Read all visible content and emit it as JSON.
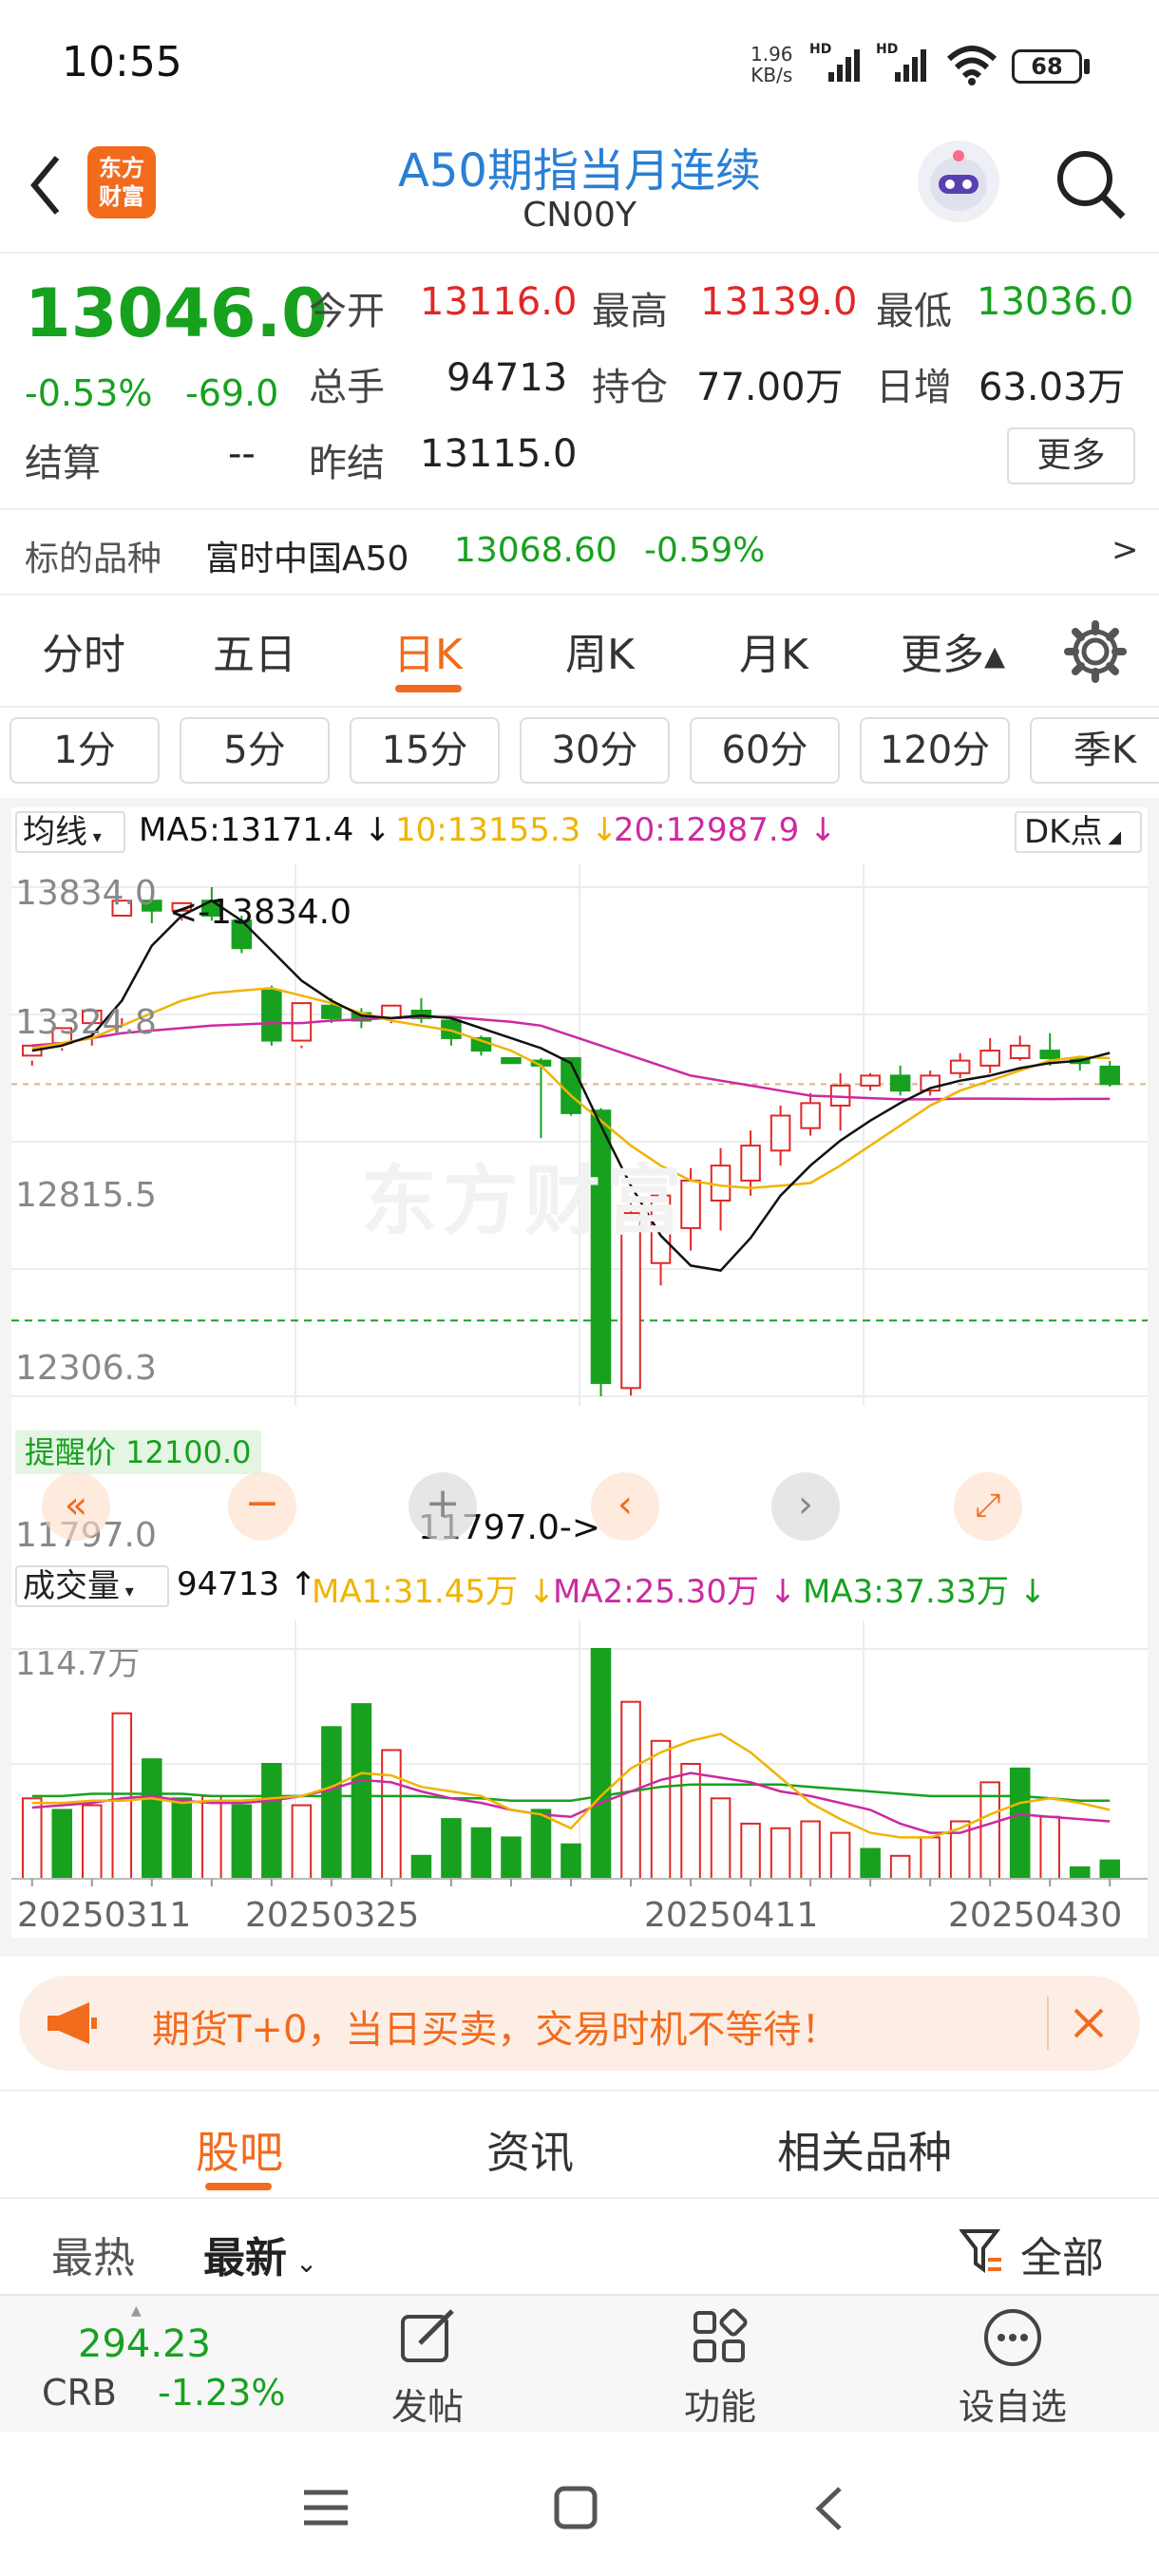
{
  "status": {
    "time": "10:55",
    "speed_top": "1.96",
    "speed_bottom": "KB/s",
    "net1": "HD",
    "net2": "HD",
    "battery": "68"
  },
  "header": {
    "title": "A50期指当月连续",
    "code": "CN00Y",
    "logo_line1": "东方",
    "logo_line2": "财富"
  },
  "quote": {
    "price": "13046.0",
    "change_pct": "-0.53%",
    "change": "-69.0",
    "open_label": "今开",
    "open": "13116.0",
    "high_label": "最高",
    "high": "13139.0",
    "low_label": "最低",
    "low": "13036.0",
    "volume_label": "总手",
    "volume": "94713",
    "oi_label": "持仓",
    "oi": "77.00万",
    "daily_inc_label": "日增",
    "daily_inc": "63.03万",
    "settle_label": "结算",
    "settle": "--",
    "prev_settle_label": "昨结",
    "prev_settle": "13115.0",
    "more": "更多",
    "underlying_label": "标的品种",
    "underlying_name": "富时中国A50",
    "underlying_price": "13068.60",
    "underlying_pct": "-0.59%",
    "underlying_arrow": ">"
  },
  "tabs": {
    "items": [
      "分时",
      "五日",
      "日K",
      "周K",
      "月K",
      "更多▴"
    ],
    "active": 2
  },
  "periods": [
    "1分",
    "5分",
    "15分",
    "30分",
    "60分",
    "120分",
    "季K"
  ],
  "ma_bar": {
    "selector": "均线",
    "ma5": "MA5:13171.4",
    "ma10": "10:13155.3",
    "ma20": "20:12987.9",
    "dk": "DK点"
  },
  "vol_bar": {
    "selector": "成交量",
    "vol": "94713",
    "ma1": "MA1:31.45万",
    "ma2": "MA2:25.30万",
    "ma3": "MA3:37.33万",
    "max": "114.7万"
  },
  "colors": {
    "up": "#e02828",
    "down": "#17a11f",
    "accent": "#f26b1d",
    "ma5": "#111111",
    "ma10": "#f0b400",
    "ma20": "#cc2aa0",
    "title": "#2a7fd4"
  },
  "chart_data": {
    "type": "candlestick",
    "y_ticks": [
      "13834.0",
      "13324.8",
      "12815.5",
      "12306.3",
      "11797.0"
    ],
    "ylim": [
      11797.0,
      13834.0
    ],
    "x_ticks": [
      "20250311",
      "20250325",
      "20250411",
      "20250430"
    ],
    "annot_high": "<-13834.0",
    "annot_low": "11797.0->",
    "alert_label": "提醒价 12100.0",
    "alert_value": 12100.0,
    "candles": [
      [
        13160,
        13200,
        13140,
        13120
      ],
      [
        13210,
        13270,
        13190,
        13180
      ],
      [
        13290,
        13340,
        13260,
        13200
      ],
      [
        13720,
        13780,
        13310,
        13280
      ],
      [
        13780,
        13740,
        13800,
        13690
      ],
      [
        13740,
        13770,
        13720,
        13700
      ],
      [
        13780,
        13720,
        13834,
        13700
      ],
      [
        13700,
        13590,
        13720,
        13570
      ],
      [
        13420,
        13220,
        13440,
        13200
      ],
      [
        13220,
        13370,
        13200,
        13190
      ],
      [
        13360,
        13310,
        13390,
        13290
      ],
      [
        13330,
        13300,
        13350,
        13270
      ],
      [
        13310,
        13360,
        13300,
        13290
      ],
      [
        13340,
        13310,
        13390,
        13290
      ],
      [
        13300,
        13230,
        13310,
        13200
      ],
      [
        13230,
        13180,
        13240,
        13160
      ],
      [
        13150,
        13130,
        13150,
        13130
      ],
      [
        13140,
        13120,
        13150,
        12830
      ],
      [
        13150,
        12930,
        13150,
        12920
      ],
      [
        12940,
        11850,
        12950,
        11797
      ],
      [
        11830,
        12530,
        12570,
        11800
      ],
      [
        12330,
        12600,
        12580,
        12240
      ],
      [
        12470,
        12660,
        12710,
        12380
      ],
      [
        12580,
        12720,
        12790,
        12460
      ],
      [
        12660,
        12800,
        12860,
        12600
      ],
      [
        12780,
        12920,
        12960,
        12720
      ],
      [
        12870,
        12970,
        13010,
        12840
      ],
      [
        12960,
        13040,
        13090,
        12860
      ],
      [
        13040,
        13080,
        13090,
        13020
      ],
      [
        13080,
        13020,
        13120,
        13000
      ],
      [
        13020,
        13080,
        13100,
        13000
      ],
      [
        13090,
        13140,
        13170,
        13070
      ],
      [
        13120,
        13180,
        13230,
        13090
      ],
      [
        13150,
        13200,
        13240,
        13140
      ],
      [
        13180,
        13150,
        13250,
        13120
      ],
      [
        13150,
        13130,
        13160,
        13100
      ],
      [
        13116,
        13046,
        13139,
        13036
      ]
    ],
    "ma5": [
      13180,
      13200,
      13240,
      13380,
      13600,
      13720,
      13780,
      13700,
      13580,
      13460,
      13380,
      13320,
      13310,
      13320,
      13310,
      13270,
      13230,
      13190,
      13130,
      12880,
      12640,
      12440,
      12320,
      12300,
      12430,
      12600,
      12720,
      12820,
      12900,
      12970,
      13030,
      13060,
      13080,
      13110,
      13130,
      13140,
      13171
    ],
    "ma10": [
      13190,
      13210,
      13230,
      13280,
      13330,
      13380,
      13410,
      13420,
      13430,
      13400,
      13370,
      13330,
      13300,
      13280,
      13260,
      13220,
      13180,
      13120,
      13000,
      12900,
      12800,
      12720,
      12660,
      12640,
      12630,
      12640,
      12650,
      12720,
      12800,
      12880,
      12960,
      13020,
      13060,
      13100,
      13140,
      13155,
      13150
    ],
    "ma20": [
      13200,
      13210,
      13230,
      13250,
      13260,
      13270,
      13280,
      13285,
      13290,
      13290,
      13300,
      13305,
      13310,
      13315,
      13315,
      13305,
      13295,
      13280,
      13240,
      13200,
      13160,
      13120,
      13080,
      13060,
      13040,
      13020,
      13000,
      12995,
      12990,
      12985,
      12985,
      12988,
      12988,
      12987,
      12986,
      12987,
      12987
    ],
    "volume": [
      [
        0.35,
        1
      ],
      [
        0.3,
        0
      ],
      [
        0.32,
        1
      ],
      [
        0.72,
        1
      ],
      [
        0.52,
        0
      ],
      [
        0.35,
        0
      ],
      [
        0.36,
        1
      ],
      [
        0.32,
        0
      ],
      [
        0.5,
        0
      ],
      [
        0.32,
        1
      ],
      [
        0.66,
        0
      ],
      [
        0.76,
        0
      ],
      [
        0.56,
        1
      ],
      [
        0.1,
        0
      ],
      [
        0.26,
        0
      ],
      [
        0.22,
        0
      ],
      [
        0.18,
        0
      ],
      [
        0.3,
        0
      ],
      [
        0.15,
        0
      ],
      [
        1.0,
        0
      ],
      [
        0.77,
        1
      ],
      [
        0.6,
        1
      ],
      [
        0.5,
        1
      ],
      [
        0.35,
        1
      ],
      [
        0.24,
        1
      ],
      [
        0.22,
        1
      ],
      [
        0.25,
        1
      ],
      [
        0.2,
        1
      ],
      [
        0.13,
        0
      ],
      [
        0.1,
        1
      ],
      [
        0.18,
        1
      ],
      [
        0.25,
        1
      ],
      [
        0.42,
        1
      ],
      [
        0.48,
        0
      ],
      [
        0.27,
        1
      ],
      [
        0.05,
        0
      ],
      [
        0.08,
        0
      ]
    ],
    "vol_ma1": [
      0.33,
      0.33,
      0.34,
      0.34,
      0.35,
      0.33,
      0.34,
      0.34,
      0.35,
      0.36,
      0.4,
      0.46,
      0.45,
      0.4,
      0.38,
      0.36,
      0.3,
      0.28,
      0.22,
      0.36,
      0.48,
      0.55,
      0.6,
      0.63,
      0.55,
      0.44,
      0.33,
      0.26,
      0.2,
      0.18,
      0.18,
      0.22,
      0.28,
      0.33,
      0.35,
      0.33,
      0.3
    ],
    "vol_ma2": [
      0.31,
      0.32,
      0.33,
      0.35,
      0.36,
      0.34,
      0.33,
      0.33,
      0.34,
      0.36,
      0.39,
      0.43,
      0.42,
      0.38,
      0.35,
      0.33,
      0.3,
      0.28,
      0.27,
      0.33,
      0.38,
      0.43,
      0.46,
      0.44,
      0.42,
      0.38,
      0.36,
      0.33,
      0.3,
      0.24,
      0.2,
      0.2,
      0.24,
      0.28,
      0.27,
      0.26,
      0.25
    ],
    "vol_ma3": [
      0.36,
      0.36,
      0.37,
      0.37,
      0.37,
      0.37,
      0.36,
      0.36,
      0.36,
      0.36,
      0.36,
      0.36,
      0.36,
      0.36,
      0.35,
      0.35,
      0.34,
      0.34,
      0.34,
      0.36,
      0.38,
      0.4,
      0.41,
      0.41,
      0.41,
      0.41,
      0.4,
      0.39,
      0.38,
      0.37,
      0.36,
      0.36,
      0.36,
      0.36,
      0.35,
      0.34,
      0.34
    ]
  },
  "watermark": "东方财富",
  "banner": {
    "text": "期货T+0，当日买卖，交易时机不等待！"
  },
  "subtabs": {
    "items": [
      "股吧",
      "资讯",
      "相关品种"
    ],
    "active": 0
  },
  "filter": {
    "hot": "最热",
    "newest": "最新",
    "all": "全部"
  },
  "bottom": {
    "index_value": "294.23",
    "index_name": "CRB",
    "index_pct": "-1.23%",
    "post": "发帖",
    "func": "功能",
    "watch": "设自选"
  }
}
